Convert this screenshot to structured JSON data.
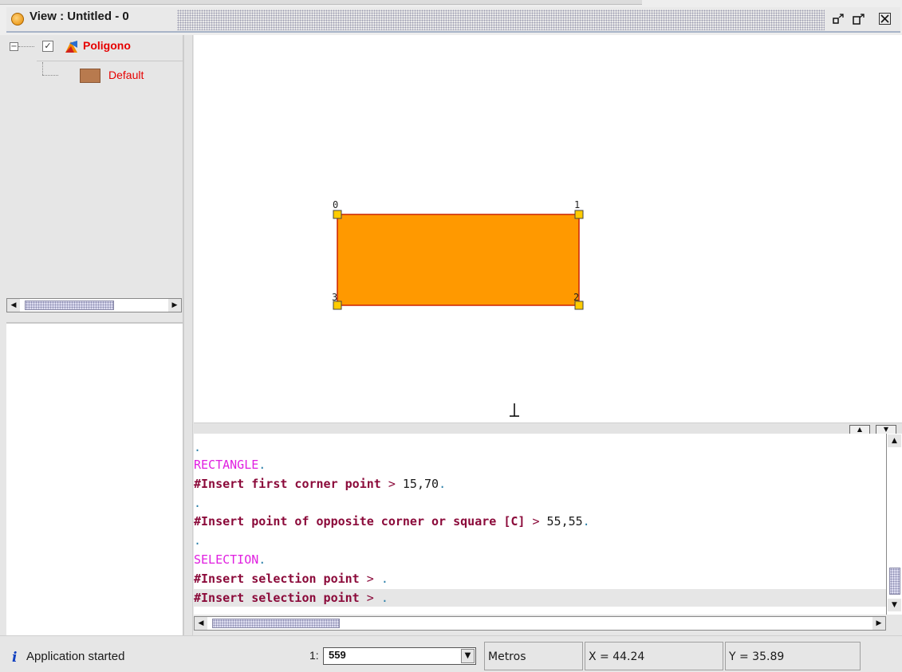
{
  "window": {
    "title": "View : Untitled - 0",
    "buttons": {
      "restore": "▫",
      "minimize": "▫",
      "close": "☒"
    }
  },
  "toc": {
    "layer": {
      "name": "Poligono",
      "checked": true,
      "expanded": true
    },
    "legend": {
      "label": "Default",
      "color": "#b87a4e"
    }
  },
  "map": {
    "polygon_fill": "#ff9900",
    "polygon_stroke": "#cc2200",
    "vertex_labels": [
      "0",
      "1",
      "2",
      "3"
    ]
  },
  "console": {
    "lines": [
      {
        "parts": [
          {
            "cls": "c-dot",
            "text": "."
          }
        ]
      },
      {
        "parts": [
          {
            "cls": "c-cmd",
            "text": "RECTANGLE"
          },
          {
            "cls": "c-dot",
            "text": "."
          }
        ]
      },
      {
        "parts": [
          {
            "cls": "c-prompt",
            "text": "#Insert first corner point"
          },
          {
            "cls": "c-sep",
            "text": " > "
          },
          {
            "cls": "c-input",
            "text": "15,70"
          },
          {
            "cls": "c-dot",
            "text": "."
          }
        ]
      },
      {
        "parts": [
          {
            "cls": "c-dot",
            "text": "."
          }
        ]
      },
      {
        "parts": [
          {
            "cls": "c-prompt",
            "text": "#Insert point of opposite corner or square [C]"
          },
          {
            "cls": "c-sep",
            "text": " > "
          },
          {
            "cls": "c-input",
            "text": "55,55"
          },
          {
            "cls": "c-dot",
            "text": "."
          }
        ]
      },
      {
        "parts": [
          {
            "cls": "c-dot",
            "text": "."
          }
        ]
      },
      {
        "parts": [
          {
            "cls": "c-cmd",
            "text": "SELECTION"
          },
          {
            "cls": "c-dot",
            "text": "."
          }
        ]
      },
      {
        "parts": [
          {
            "cls": "c-prompt",
            "text": "#Insert selection point"
          },
          {
            "cls": "c-sep",
            "text": " > "
          },
          {
            "cls": "c-dot",
            "text": "."
          }
        ]
      },
      {
        "parts": [
          {
            "cls": "c-prompt",
            "text": "#Insert selection point"
          },
          {
            "cls": "c-sep",
            "text": " > "
          },
          {
            "cls": "c-dot",
            "text": "."
          }
        ],
        "highlight": true
      }
    ]
  },
  "status": {
    "message": "Application started",
    "scale_prefix": "1:",
    "scale_value": "559",
    "units": "Metros",
    "x": "X = 44.24",
    "y": "Y = 35.89"
  }
}
